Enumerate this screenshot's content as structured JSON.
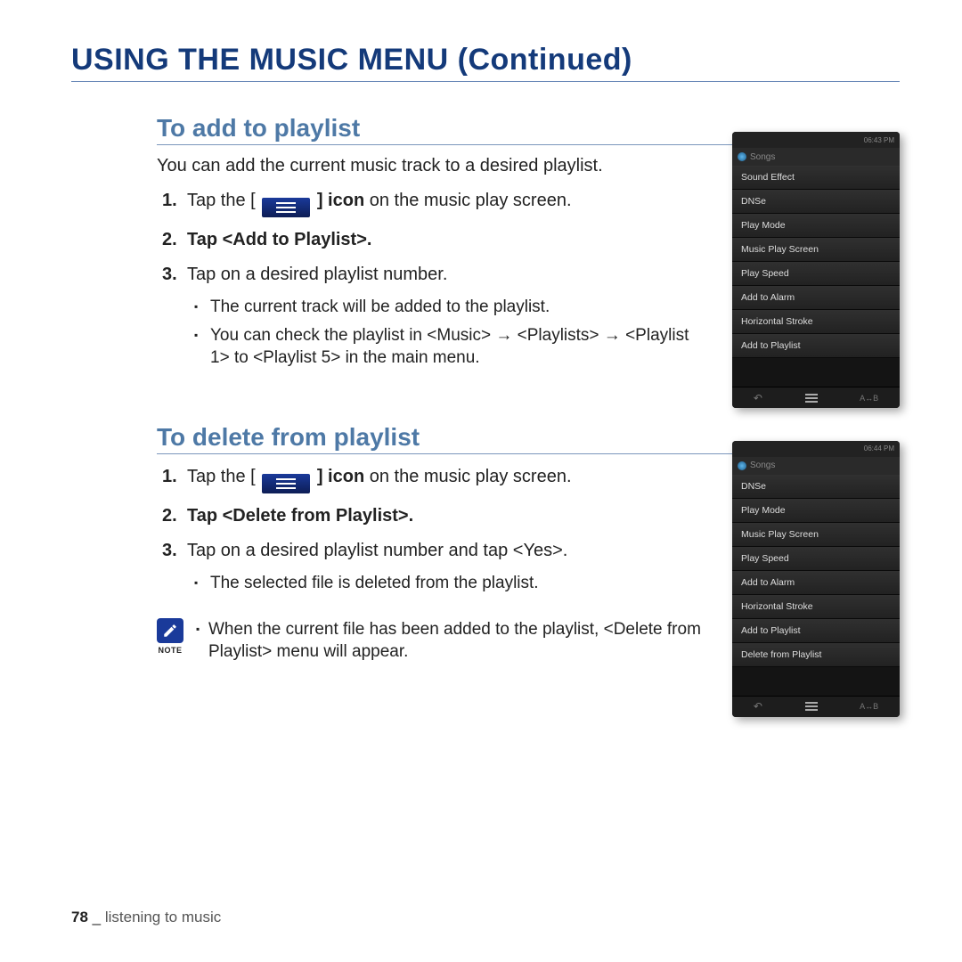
{
  "page_title": "USING THE MUSIC MENU (Continued)",
  "sections": [
    {
      "heading": "To add to playlist",
      "intro": "You can add the current music track to a desired playlist.",
      "steps": [
        {
          "num": "1.",
          "pre": "Tap the [ ",
          "icon": true,
          "post": " ] icon",
          "post_bold": true,
          "tail": " on the music play screen."
        },
        {
          "num": "2.",
          "text": "Tap <Add to Playlist>.",
          "bold": true
        },
        {
          "num": "3.",
          "text": "Tap on a desired playlist number."
        }
      ],
      "sub": [
        "The current track will be added to the playlist.",
        "You can check the playlist in <Music> → <Playlists> → <Playlist 1> to <Playlist 5> in the main menu."
      ],
      "device": {
        "time": "06:43 PM",
        "title": "Songs",
        "items": [
          "Sound Effect",
          "DNSe",
          "Play Mode",
          "Music Play Screen",
          "Play Speed",
          "Add to Alarm",
          "Horizontal Stroke",
          "Add to Playlist"
        ],
        "ab": "A↔B"
      }
    },
    {
      "heading": "To delete from playlist",
      "steps": [
        {
          "num": "1.",
          "pre": "Tap the [ ",
          "icon": true,
          "post": " ] icon",
          "post_bold": true,
          "tail": " on the music play screen."
        },
        {
          "num": "2.",
          "text": "Tap <Delete from Playlist>.",
          "bold": true
        },
        {
          "num": "3.",
          "text": "Tap on a desired playlist number and tap <Yes>."
        }
      ],
      "sub": [
        "The selected file is deleted from the playlist."
      ],
      "note": {
        "label": "NOTE",
        "text": "When the current file has been added to the playlist, <Delete from Playlist> menu will appear."
      },
      "device": {
        "time": "06:44 PM",
        "title": "Songs",
        "items": [
          "DNSe",
          "Play Mode",
          "Music Play Screen",
          "Play Speed",
          "Add to Alarm",
          "Horizontal Stroke",
          "Add to Playlist",
          "Delete from Playlist"
        ],
        "ab": "A↔B"
      }
    }
  ],
  "footer": {
    "page": "78",
    "sep": "_",
    "chapter": "listening to music"
  }
}
